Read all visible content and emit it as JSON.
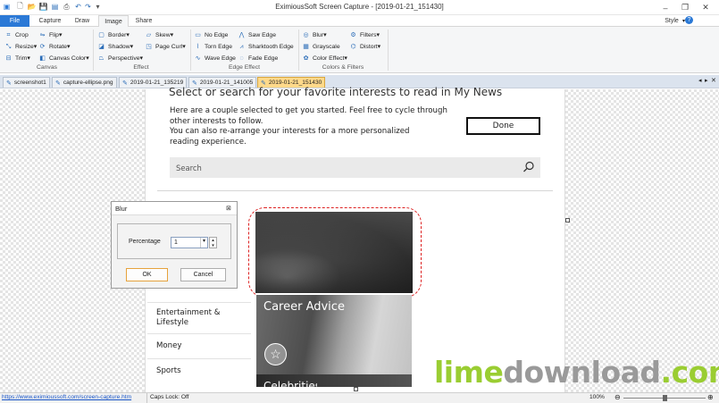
{
  "window": {
    "title": "EximiousSoft Screen Capture - [2019-01-21_151430]",
    "controls": {
      "minimize": "–",
      "restore": "❐",
      "close": "✕"
    }
  },
  "ribbon_tabs": [
    "File",
    "Capture",
    "Draw",
    "Image",
    "Share"
  ],
  "active_tab": "Image",
  "style_menu": "Style",
  "groups": {
    "canvas": {
      "label": "Canvas",
      "items": [
        "Crop",
        "Resize",
        "Trim",
        "Flip",
        "Rotate",
        "Canvas Color"
      ]
    },
    "effect": {
      "label": "Effect",
      "items": [
        "Border",
        "Shadow",
        "Perspective",
        "Skew",
        "Page Curl"
      ]
    },
    "edge_effect": {
      "label": "Edge Effect",
      "items": [
        "No Edge",
        "Torn Edge",
        "Wave Edge",
        "Saw Edge",
        "Sharktooth Edge",
        "Fade Edge"
      ]
    },
    "colors_filters": {
      "label": "Colors & Filters",
      "items": [
        "Blur",
        "Grayscale",
        "Color Effect",
        "Filters",
        "Distort"
      ]
    }
  },
  "doc_tabs": [
    "screenshot1",
    "capture-ellipse.png",
    "2019-01-21_135219",
    "2019-01-21_141005",
    "2019-01-21_151430"
  ],
  "active_doc_tab": "2019-01-21_151430",
  "page": {
    "heading": "Select or search for your favorite interests to read in My News",
    "intro1": "Here are a couple selected to get you started. Feel free to cycle through other interests to follow.",
    "intro2": "You can also re-arrange your interests for a more personalized reading experience.",
    "done": "Done",
    "search_placeholder": "Search",
    "categories": [
      "Entertainment & Lifestyle",
      "Money",
      "Sports"
    ],
    "card_title": "Career Advice",
    "card_partial": "Celebrities"
  },
  "blur_dialog": {
    "title": "Blur",
    "percentage_label": "Percentage",
    "percentage_value": "1",
    "ok": "OK",
    "cancel": "Cancel"
  },
  "status": {
    "url": "https://www.eximioussoft.com/screen-capture.htm",
    "caps": "Caps Lock: Off",
    "zoom": "100%"
  },
  "watermark": {
    "part1": "lime",
    "part2": "download",
    "part3": ".com"
  },
  "colors": {
    "accent": "#2b79d6",
    "active_doc_tab": "#ffd98a",
    "selection": "#dd2222",
    "watermark_green": "#9acd32",
    "watermark_gray": "#9a9a9a"
  }
}
